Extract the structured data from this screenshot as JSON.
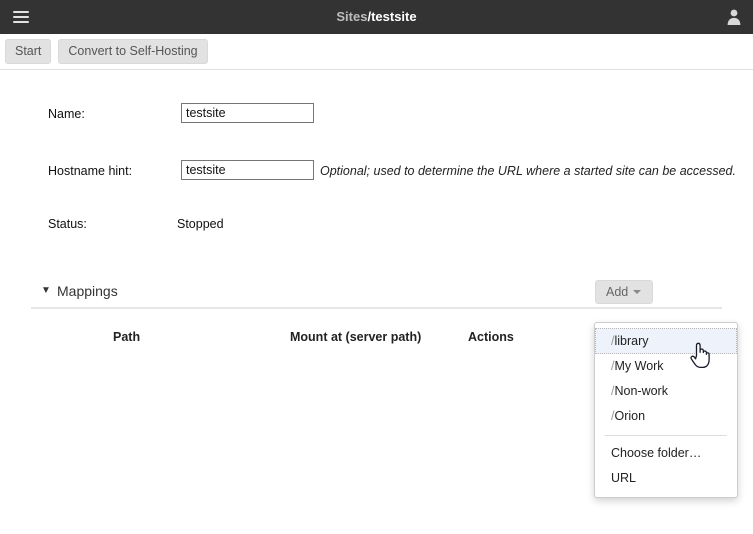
{
  "window": {
    "titlebar": {
      "menu_icon": "hamburger-icon",
      "breadcrumb_parent": "Sites",
      "breadcrumb_separator": "/",
      "breadcrumb_current": "testsite",
      "account_icon": "user-icon"
    }
  },
  "toolbar": {
    "start_label": "Start",
    "convert_label": "Convert to Self-Hosting"
  },
  "form": {
    "name": {
      "label": "Name:",
      "value": "testsite",
      "placeholder": ""
    },
    "hostname": {
      "label": "Hostname hint:",
      "value": "testsite",
      "placeholder": "",
      "hint": "Optional; used to determine the URL where a started site can be accessed."
    },
    "status": {
      "label": "Status:",
      "value": "Stopped"
    }
  },
  "mappings": {
    "disclosure_glyph": "▼",
    "title": "Mappings",
    "add_label": "Add",
    "columns": {
      "path": "Path",
      "mount_at": "Mount at (server path)",
      "actions": "Actions"
    },
    "rows": []
  },
  "add_dropdown": {
    "visible": true,
    "items": [
      {
        "slash": "/",
        "label": "library",
        "active": true
      },
      {
        "slash": "/",
        "label": "My Work",
        "active": false
      },
      {
        "slash": "/",
        "label": "Non-work",
        "active": false
      },
      {
        "slash": "/",
        "label": "Orion",
        "active": false
      }
    ],
    "extra_items": [
      {
        "label": "Choose folder…"
      },
      {
        "label": "URL"
      }
    ]
  },
  "colors": {
    "titlebar_bg": "#333333",
    "button_bg": "#e2e2e2",
    "highlight_bg": "#eef2fb",
    "divider": "#e6e6e6"
  }
}
